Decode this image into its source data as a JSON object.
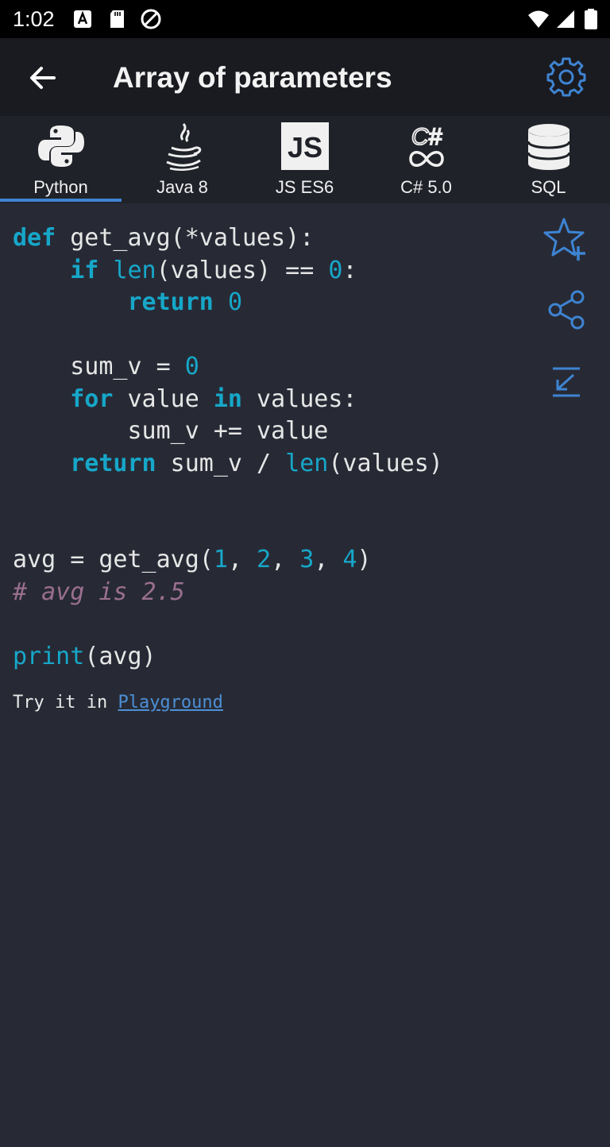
{
  "status_bar": {
    "time": "1:02"
  },
  "app_bar": {
    "title": "Array of parameters"
  },
  "tabs": [
    {
      "label": "Python",
      "icon": "python-icon",
      "selected": true
    },
    {
      "label": "Java 8",
      "icon": "java-icon"
    },
    {
      "label": "JS ES6",
      "icon": "javascript-icon",
      "badge": "JS"
    },
    {
      "label": "C# 5.0",
      "icon": "csharp-icon",
      "badge": "C#"
    },
    {
      "label": "SQL",
      "icon": "database-icon"
    }
  ],
  "code": {
    "l1": {
      "kw": "def",
      "rest": " get_avg(*values):"
    },
    "l2": {
      "indent": "    ",
      "kw": "if",
      "sp": " ",
      "bi": "len",
      "mid": "(values) == ",
      "num": "0",
      "end": ":"
    },
    "l3": {
      "indent": "        ",
      "kw": "return",
      "sp": " ",
      "num": "0"
    },
    "l5": {
      "pre": "    sum_v = ",
      "num": "0"
    },
    "l6": {
      "indent": "    ",
      "kw1": "for",
      "mid": " value ",
      "kw2": "in",
      "end": " values:"
    },
    "l7": {
      "text": "        sum_v += value"
    },
    "l8": {
      "indent": "    ",
      "kw": "return",
      "mid": " sum_v / ",
      "bi": "len",
      "end": "(values)"
    },
    "l11": {
      "pre": "avg = get_avg(",
      "n1": "1",
      "c1": ", ",
      "n2": "2",
      "c2": ", ",
      "n3": "3",
      "c3": ", ",
      "n4": "4",
      "end": ")"
    },
    "l12": {
      "comment": "# avg is 2.5"
    },
    "l14": {
      "bi": "print",
      "end": "(avg)"
    }
  },
  "footer": {
    "prefix": "Try it in ",
    "link": "Playground"
  },
  "colors": {
    "accent": "#3e84d2",
    "keyword": "#16a7c9",
    "comment": "#9a6f8f",
    "background": "#272a35"
  }
}
